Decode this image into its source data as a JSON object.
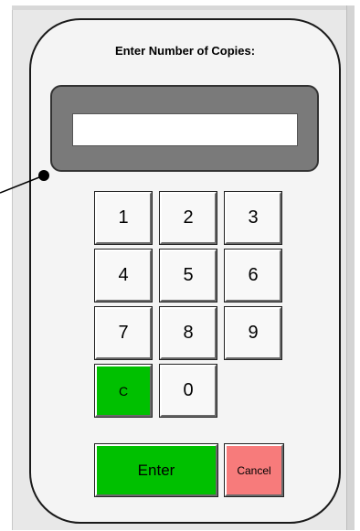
{
  "title": "Enter Number of Copies:",
  "display": {
    "value": ""
  },
  "keys": {
    "k1": "1",
    "k2": "2",
    "k3": "3",
    "k4": "4",
    "k5": "5",
    "k6": "6",
    "k7": "7",
    "k8": "8",
    "k9": "9",
    "clear": "C",
    "k0": "0",
    "enter": "Enter",
    "cancel": "Cancel"
  },
  "colors": {
    "clear_key": "#00c000",
    "enter_key": "#00c000",
    "cancel_key": "#f77b7b",
    "display_bezel": "#7a7a7a"
  }
}
